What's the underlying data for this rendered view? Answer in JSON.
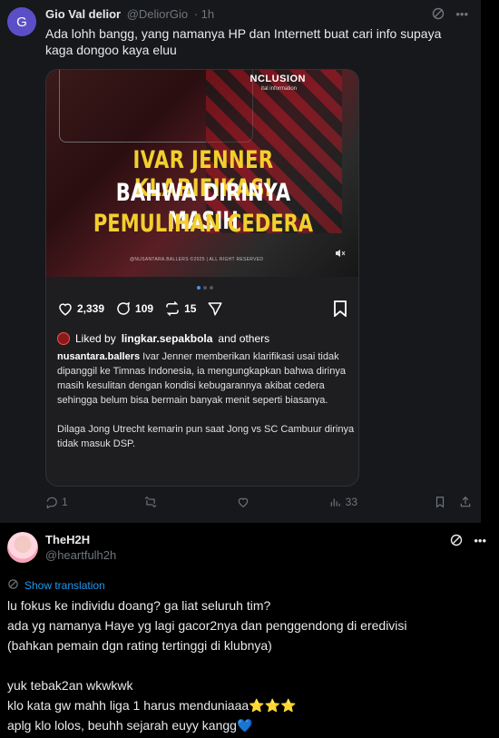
{
  "reply_post": {
    "avatar_letter": "G",
    "author_name": "Gio Val delior",
    "author_handle": "@DeliorGio",
    "time": "· 1h",
    "text": "Ada lohh bangg, yang namanya HP dan Internett buat cari info supaya kaga dongoo kaya eluu",
    "actions": {
      "reply": "1",
      "repost": "",
      "like": "",
      "views": "33"
    },
    "embed": {
      "sponsor": "NCLUSION",
      "sponsor_sub": "ital information",
      "headline_1": "IVAR JENNER KLARIFIKASI",
      "headline_2": "BAHWA DIRINYA MASIH",
      "headline_3": "PEMULIHAN CEDERA",
      "copyright": "@NUSANTARA.BALLERS ©2025 | ALL RIGHT RESERVED",
      "likes": "2,339",
      "comments": "109",
      "reposts": "15",
      "liked_by_prefix": "Liked by",
      "liked_by_user": "lingkar.sepakbola",
      "liked_by_suffix": "and others",
      "caption_user": "nusantara.ballers",
      "caption_text": "Ivar Jenner memberikan klarifikasi usai tidak dipanggil ke Timnas Indonesia, ia mengungkapkan bahwa dirinya masih kesulitan dengan kondisi kebugarannya akibat cedera sehingga belum bisa bermain banyak menit seperti biasanya.",
      "caption_text_2": "Dilaga Jong Utrecht kemarin pun saat Jong vs SC Cambuur dirinya tidak masuk DSP."
    }
  },
  "main_post": {
    "author_name": "TheH2H",
    "author_handle": "@heartfulh2h",
    "translate_label": "Show translation",
    "text": "lu fokus ke individu doang? ga liat seluruh tim?\nada yg namanya Haye yg lagi gacor2nya dan penggendong di eredivisi\n(bahkan pemain dgn rating tertinggi di klubnya)\n\nyuk tebak2an wkwkwk\nklo kata gw mahh liga 1 harus menduniaaa⭐⭐⭐\naplg klo lolos, beuhh sejarah euyy kangg💙"
  },
  "icons": {
    "more": "more-horizontal-icon",
    "grok": "grok-slash-icon"
  },
  "colors": {
    "accent": "#1d9bf0",
    "headline_yellow": "#f3cf2e",
    "brand_avatar": "#5b4fc7"
  }
}
